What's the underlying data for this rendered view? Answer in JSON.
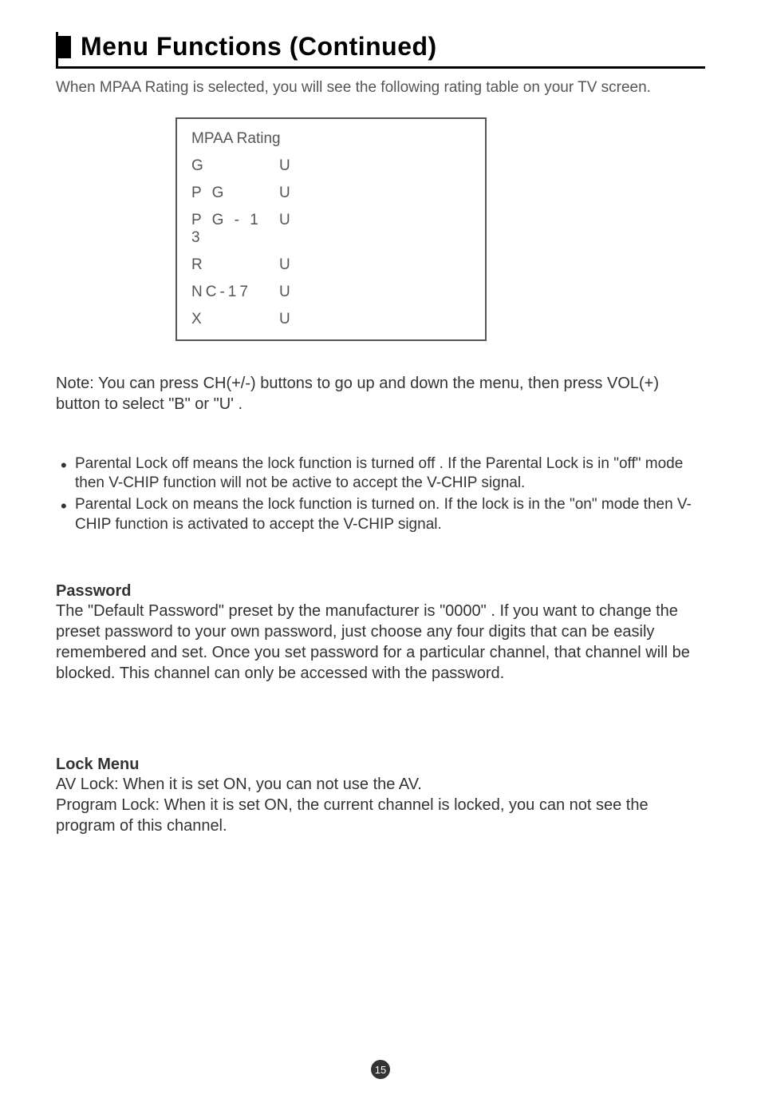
{
  "title": "Menu Functions (Continued)",
  "intro": "When MPAA Rating is selected, you will see the following rating table on your TV screen.",
  "ratingBox": {
    "heading": "MPAA Rating",
    "rows": [
      {
        "label": "G",
        "value": "U"
      },
      {
        "label": "P G",
        "value": "U"
      },
      {
        "label": "P G - 1 3",
        "value": "U"
      },
      {
        "label": "R",
        "value": "U"
      },
      {
        "label": "NC-17",
        "value": "U"
      },
      {
        "label": "X",
        "value": "U"
      }
    ]
  },
  "note": "Note: You can press  CH(+/-) buttons to go up and down the menu, then press VOL(+) button to select   \"B\"  or  \"U' .",
  "bullets": [
    "Parental Lock  off means  the lock function is turned off . If the Parental Lock is in  \"off\" mode then V-CHIP function will not be active to accept the V-CHIP  signal.",
    "Parental Lock on means the lock function is turned on. If the  lock is in the \"on\" mode then V-CHIP function is activated to accept the V-CHIP signal."
  ],
  "passwordHeading": "Password",
  "passwordBody": "The \"Default Password\" preset by the manufacturer is \"0000\" . If you want to change the preset password to your own password, just choose any four digits that can be easily remembered and set. Once you set password for a particular channel, that channel will be blocked.  This channel can only be accessed with the password.",
  "lockMenuHeading": "Lock Menu",
  "lockMenuBody": "AV Lock: When it is set ON, you can not use the AV.\nProgram Lock: When it is set ON, the current channel is locked, you can not see the program of this channel.",
  "pageNumber": "15"
}
